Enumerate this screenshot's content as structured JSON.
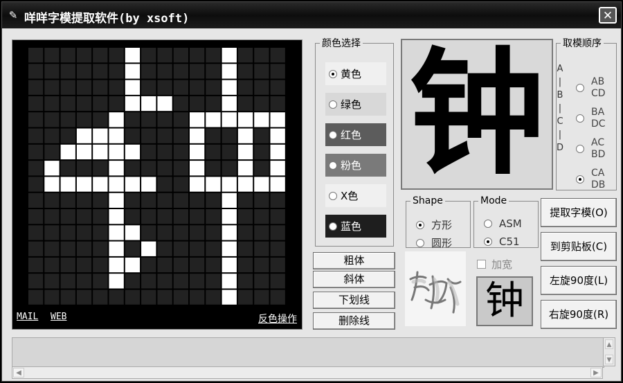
{
  "window": {
    "title": "咩咩字模提取软件(by xsoft)",
    "close_glyph": "✕",
    "app_icon": "✎"
  },
  "grid": {
    "cols": 16,
    "rows": 16,
    "on_color": "#ffffff",
    "off_color": "#222222",
    "pattern": [
      "0000001000001000",
      "0000001000001000",
      "0000001000001000",
      "0000001110001000",
      "0000010000111111",
      "0001110000100101",
      "0011111000100101",
      "0100010000100101",
      "0111111100111111",
      "0000010000001000",
      "0000010000001000",
      "0000011000001000",
      "0000010100001000",
      "0000011000001000",
      "0000010000001000",
      "0000000000001000"
    ],
    "links": {
      "mail": "MAIL",
      "web": "WEB",
      "invert": "反色操作"
    }
  },
  "color_select": {
    "legend": "颜色选择",
    "selected": "黄色",
    "options": [
      {
        "label": "黄色",
        "bg": "#f0f0f0",
        "fg": "#000000",
        "checked": true
      },
      {
        "label": "绿色",
        "bg": "#d8d8d8",
        "fg": "#000000",
        "checked": false
      },
      {
        "label": "红色",
        "bg": "#5c5c5c",
        "fg": "#ffffff",
        "checked": false
      },
      {
        "label": "粉色",
        "bg": "#7a7a7a",
        "fg": "#ffffff",
        "checked": false
      },
      {
        "label": "X色",
        "bg": "#f0f0f0",
        "fg": "#000000",
        "checked": false
      },
      {
        "label": "蓝色",
        "bg": "#1e1e1e",
        "fg": "#ffffff",
        "checked": false
      }
    ]
  },
  "preview": {
    "char": "钟"
  },
  "order": {
    "legend": "取模顺序",
    "letters": [
      "A",
      "|",
      "B",
      "|",
      "C",
      "|",
      "D"
    ],
    "options": [
      {
        "line1": "AB",
        "line2": "CD",
        "checked": false
      },
      {
        "line1": "BA",
        "line2": "DC",
        "checked": false
      },
      {
        "line1": "AC",
        "line2": "BD",
        "checked": false
      },
      {
        "line1": "CA",
        "line2": "DB",
        "checked": true
      }
    ]
  },
  "shape": {
    "legend": "Shape",
    "options": [
      {
        "label": "方形",
        "checked": true
      },
      {
        "label": "圆形",
        "checked": false
      }
    ]
  },
  "mode": {
    "legend": "Mode",
    "options": [
      {
        "label": "ASM",
        "checked": false
      },
      {
        "label": "C51",
        "checked": true
      }
    ]
  },
  "style_buttons": [
    "粗体",
    "斜体",
    "下划线",
    "删除线"
  ],
  "action_buttons": [
    "提取字模(O)",
    "到剪贴板(C)",
    "左旋90度(L)",
    "右旋90度(R)"
  ],
  "widen": {
    "label": "加宽",
    "checked": false
  },
  "small_preview": {
    "char": "钟"
  },
  "logo": {
    "text": "咩咩"
  },
  "scroll": {
    "up": "▲",
    "down": "▼",
    "left": "◀",
    "right": "▶"
  }
}
